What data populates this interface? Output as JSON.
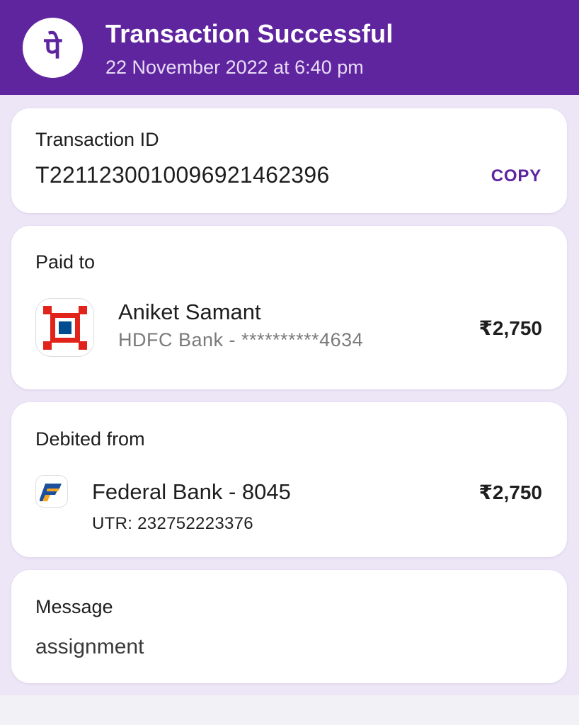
{
  "header": {
    "title": "Transaction Successful",
    "datetime": "22 November 2022 at 6:40 pm",
    "logo_glyph": "पे",
    "colors": {
      "brand": "#5f259f"
    }
  },
  "transaction": {
    "label": "Transaction ID",
    "id": "T2211230010096921462396",
    "copy_label": "COPY"
  },
  "paid_to": {
    "label": "Paid to",
    "name": "Aniket Samant",
    "account": "HDFC Bank - **********4634",
    "amount": "₹2,750",
    "icon": "hdfc-bank-icon"
  },
  "debited_from": {
    "label": "Debited from",
    "account": "Federal Bank - 8045",
    "utr": "UTR: 232752223376",
    "amount": "₹2,750",
    "icon": "federal-bank-icon"
  },
  "message": {
    "label": "Message",
    "text": "assignment"
  }
}
